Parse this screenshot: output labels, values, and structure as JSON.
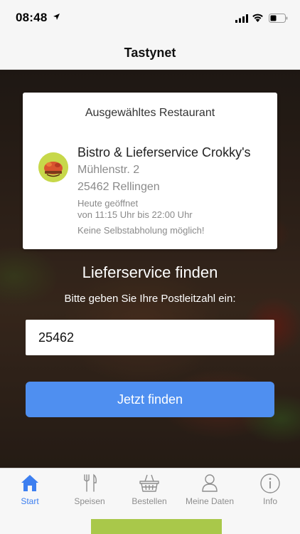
{
  "status": {
    "time": "08:48"
  },
  "nav": {
    "title": "Tastynet"
  },
  "card": {
    "heading": "Ausgewähltes Restaurant",
    "restaurant": {
      "name": "Bistro & Lieferservice Crokky's",
      "street": "Mühlenstr. 2",
      "city": "25462 Rellingen",
      "open_today": "Heute geöffnet",
      "hours": "von 11:15 Uhr bis 22:00 Uhr",
      "pickup": "Keine Selbstabholung möglich!"
    }
  },
  "finder": {
    "title": "Lieferservice finden",
    "subtitle": "Bitte geben Sie Ihre Postleitzahl ein:",
    "zip_value": "25462",
    "button_label": "Jetzt finden"
  },
  "tabs": [
    {
      "label": "Start",
      "icon": "home-icon",
      "active": true
    },
    {
      "label": "Speisen",
      "icon": "cutlery-icon",
      "active": false
    },
    {
      "label": "Bestellen",
      "icon": "basket-icon",
      "active": false
    },
    {
      "label": "Meine Daten",
      "icon": "user-icon",
      "active": false
    },
    {
      "label": "Info",
      "icon": "info-icon",
      "active": false
    }
  ],
  "colors": {
    "accent": "#4f8ff0",
    "tab_active": "#3d7ff0",
    "tab_inactive": "#8e8e8e",
    "logo_green": "#c7d84a",
    "strip_green": "#a9c84a"
  }
}
